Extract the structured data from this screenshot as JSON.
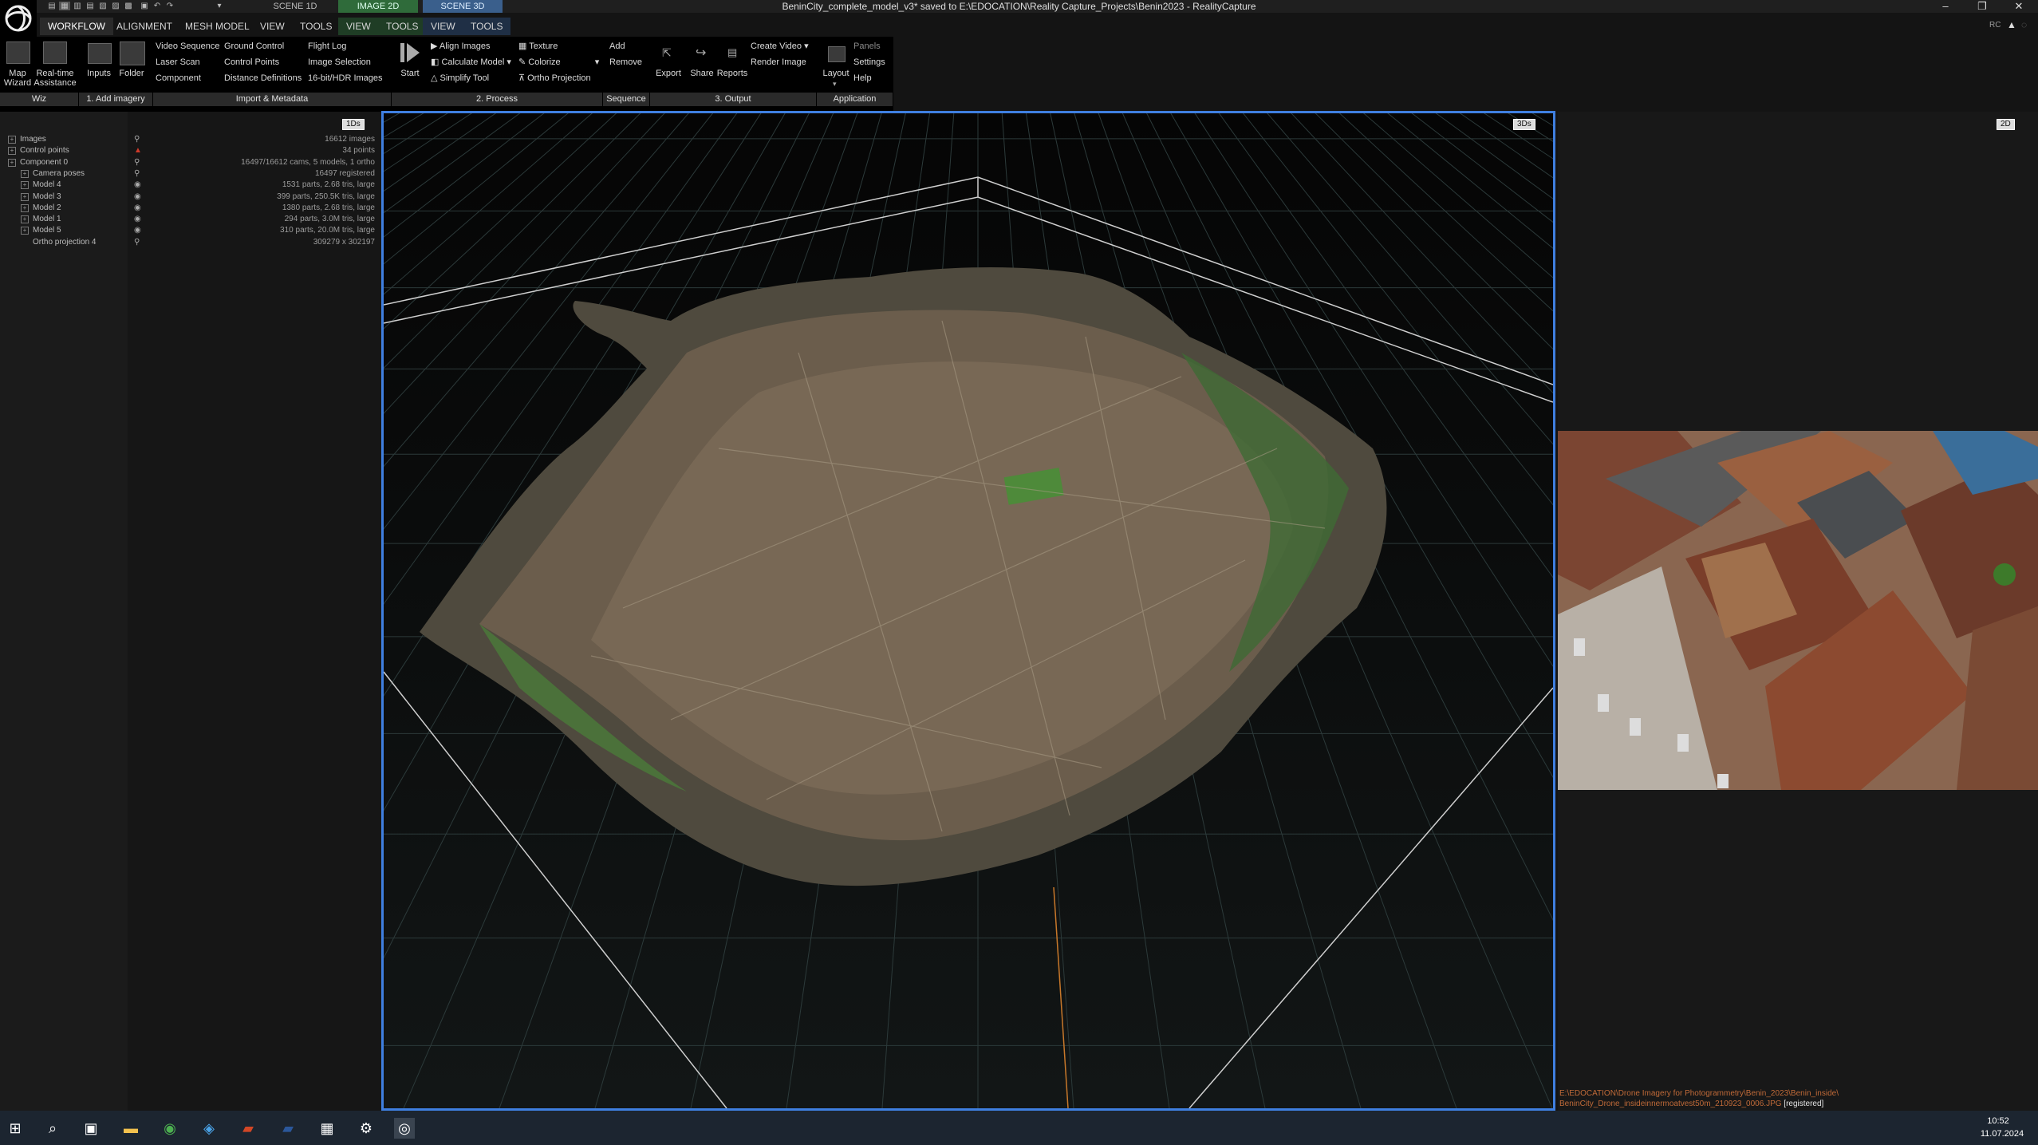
{
  "window": {
    "title": "BeninCity_complete_model_v3* saved to E:\\EDOCATION\\Reality Capture_Projects\\Benin2023 - RealityCapture",
    "minimize": "–",
    "restore": "❐",
    "close": "✕"
  },
  "scene_tabs": [
    "SCENE 1D",
    "IMAGE 2D",
    "SCENE 3D"
  ],
  "menu_tabs": [
    "WORKFLOW",
    "ALIGNMENT",
    "MESH MODEL",
    "VIEW",
    "TOOLS",
    "VIEW",
    "TOOLS",
    "VIEW",
    "TOOLS"
  ],
  "ribbon": {
    "wiz": {
      "map_wizard": "Map\nWizard",
      "realtime": "Real-time\nAssistance",
      "group": "Wiz"
    },
    "add_imagery": {
      "inputs": "Inputs",
      "folder": "Folder",
      "group": "1. Add imagery"
    },
    "import": {
      "items": [
        "Video Sequence",
        "Laser Scan",
        "Component",
        "Ground Control",
        "Control Points",
        "Distance Definitions",
        "Flight Log",
        "Image Selection",
        "16-bit/HDR Images"
      ],
      "group": "Import & Metadata"
    },
    "process": {
      "start": "Start",
      "items": [
        "Align Images",
        "Calculate Model",
        "Simplify Tool",
        "Texture",
        "Colorize",
        "Ortho Projection"
      ],
      "group": "2. Process"
    },
    "sequence": {
      "add": "Add",
      "remove": "Remove",
      "group": "Sequence"
    },
    "output": {
      "export": "Export",
      "share": "Share",
      "reports": "Reports",
      "create_video": "Create Video",
      "render_image": "Render Image",
      "group": "3. Output"
    },
    "application": {
      "layout": "Layout",
      "panels": "Panels",
      "settings": "Settings",
      "help": "Help",
      "group": "Application"
    }
  },
  "left_panel": {
    "badge": "1Ds",
    "tree": [
      {
        "label": "Images",
        "value": "16612 images",
        "expand": true,
        "indent": 0
      },
      {
        "label": "Control points",
        "value": "34 points",
        "expand": true,
        "indent": 0
      },
      {
        "label": "Component 0",
        "value": "16497/16612 cams, 5 models, 1 ortho",
        "expand": true,
        "indent": 0
      },
      {
        "label": "Camera poses",
        "value": "16497 registered",
        "expand": true,
        "indent": 1
      },
      {
        "label": "Model 4",
        "value": "1531 parts, 2.68 tris, large",
        "expand": true,
        "indent": 1
      },
      {
        "label": "Model 3",
        "value": "399 parts, 250.5K tris, large",
        "expand": true,
        "indent": 1
      },
      {
        "label": "Model 2",
        "value": "1380 parts, 2.68 tris, large",
        "expand": true,
        "indent": 1
      },
      {
        "label": "Model 1",
        "value": "294 parts, 3.0M tris, large",
        "expand": true,
        "indent": 1
      },
      {
        "label": "Model 5",
        "value": "310 parts, 20.0M tris, large",
        "expand": true,
        "indent": 1
      },
      {
        "label": "Ortho projection 4",
        "value": "309279 x 302197",
        "expand": false,
        "indent": 1
      }
    ]
  },
  "view3d": {
    "badge": "3Ds"
  },
  "view2d": {
    "badge": "2D",
    "path_line1": "E:\\EDOCATION\\Drone Imagery for Photogrammetry\\Benin_2023\\Benin_inside\\",
    "path_line2": "BeninCity_Drone_insideinnermoatvest50m_210923_0006.JPG",
    "status": "[registered]"
  },
  "status_icons": {
    "rc": "RC"
  },
  "taskbar": {
    "time": "10:52",
    "date": "11.07.2024"
  },
  "colors": {
    "accent": "#3f7fe0",
    "scene2d_tab": "#2f6b3a",
    "scene3d_tab": "#3a5f8c"
  }
}
